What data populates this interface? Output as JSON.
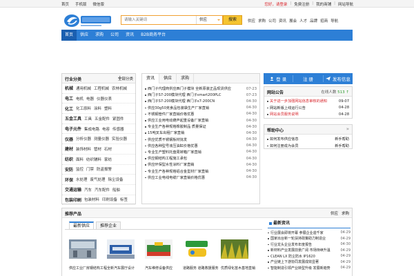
{
  "topbar": {
    "left": [
      "首页",
      "手机版",
      "微信版"
    ],
    "right": [
      "您好，请登录",
      "免费注册",
      "我的商铺",
      "网站导航"
    ]
  },
  "search": {
    "placeholder": "请输入关键词",
    "select": "供应",
    "button": "搜索"
  },
  "hotlinks": [
    "供应",
    "求购",
    "公司",
    "资讯",
    "展会",
    "人才",
    "品牌",
    "招商",
    "导航"
  ],
  "nav": [
    {
      "label": "首页",
      "active": true
    },
    {
      "label": "供应"
    },
    {
      "label": "求购"
    },
    {
      "label": "公司"
    },
    {
      "label": "资讯"
    },
    {
      "label": "B2B商务平台"
    }
  ],
  "categories": {
    "title": "行业分类",
    "all": "全部分类",
    "rows": [
      {
        "main": "机械",
        "subs": [
          "通用机械",
          "工程机械",
          "农林机械"
        ]
      },
      {
        "main": "电工",
        "subs": [
          "电机",
          "电器",
          "仪器仪表"
        ]
      },
      {
        "main": "化工",
        "subs": [
          "化工原料",
          "涂料",
          "塑料"
        ]
      },
      {
        "main": "五金工具",
        "subs": [
          "工具",
          "五金配件",
          "紧固件"
        ]
      },
      {
        "main": "电子元件",
        "subs": [
          "集成电路",
          "电容",
          "传感器"
        ]
      },
      {
        "main": "仪器",
        "subs": [
          "分析仪器",
          "测量仪器",
          "实验仪器"
        ]
      },
      {
        "main": "建材",
        "subs": [
          "装饰材料",
          "管材",
          "石材"
        ]
      },
      {
        "main": "纺织",
        "subs": [
          "面料",
          "纺织辅料",
          "家纺"
        ]
      },
      {
        "main": "安防",
        "subs": [
          "监控",
          "门禁",
          "防盗报警"
        ]
      },
      {
        "main": "环保",
        "subs": [
          "水处理",
          "废气处理",
          "除尘设备"
        ]
      },
      {
        "main": "交通运输",
        "subs": [
          "汽车",
          "汽车配件",
          "船舶"
        ]
      },
      {
        "main": "包装印刷",
        "subs": [
          "包装材料",
          "印刷设备",
          "标签"
        ]
      }
    ]
  },
  "news": {
    "tabs": [
      "资讯",
      "供应",
      "求购"
    ],
    "rows": [
      {
        "title": "西门子代理商供应西门子模块 全新原装正品现货供应",
        "date": "07-23"
      },
      {
        "title": "西门子S7-200模块代理 西门子smart200PLC",
        "date": "07-23"
      },
      {
        "title": "西门子S7-200模块代理 西门子s7-200CN",
        "date": "04-30"
      },
      {
        "title": "供应30g50克食品包装袋生产厂家直销",
        "date": "04-30"
      },
      {
        "title": "不锈钢管件厂家直销价格优惠",
        "date": "04-30"
      },
      {
        "title": "供应工业用电动葫芦起重设备厂家直销",
        "date": "04-30"
      },
      {
        "title": "专业生产各种规格橡胶制品 质量保证",
        "date": "04-30"
      },
      {
        "title": "15吨叉车出租厂家直销",
        "date": "04-30"
      },
      {
        "title": "供应优质不锈钢板材批发",
        "date": "04-30"
      },
      {
        "title": "供应各种型号液压油缸价格优惠",
        "date": "04-30"
      },
      {
        "title": "专业生产塑料托盘周转箱厂家直销",
        "date": "04-30"
      },
      {
        "title": "供应钢结构工程施工承包",
        "date": "04-30"
      },
      {
        "title": "供应环保型水性涂料厂家直销",
        "date": "04-30"
      },
      {
        "title": "专业生产各种规格铝合金型材厂家直销",
        "date": "04-30"
      },
      {
        "title": "供应工业电线电缆厂家直销价格优惠",
        "date": "04-30"
      }
    ]
  },
  "account": {
    "login": "登 录",
    "register": "注 册",
    "publish": "发布信息"
  },
  "notice": {
    "title": "网站公告",
    "online_label": "在线人数",
    "online_value": "513",
    "rows": [
      {
        "title": "关于进一步加强网站信息审核的通知",
        "date": "09-07",
        "highlight": true
      },
      {
        "title": "网站新版上线运行公告",
        "date": "04-28",
        "highlight": false
      },
      {
        "title": "网站会员服务说明",
        "date": "04-28",
        "highlight": true
      }
    ]
  },
  "tips": {
    "title": "帮助中心",
    "more": "»",
    "rows": [
      {
        "title": "如何发布供应信息",
        "tag": "新手帮助"
      },
      {
        "title": "如何注册成为会员",
        "tag": "新手帮助"
      }
    ]
  },
  "products": {
    "title": "推荐产品",
    "right": [
      "供应",
      "求购"
    ],
    "subtabs": [
      "最新供应",
      "推荐企业"
    ],
    "thumbs": [
      {
        "caption": "供应工业厂房钢结构工程"
      },
      {
        "caption": "全新汽车展厅设计"
      },
      {
        "caption": "汽车维修设备供应"
      },
      {
        "caption": "道路服务 道路救援服务"
      },
      {
        "caption": "优质绿化苗木基地直销"
      }
    ],
    "latest": {
      "title": "最新资讯",
      "rows": [
        {
          "title": "行业展会即将开幕 参展企业逾千家",
          "date": "04-29"
        },
        {
          "title": "国家出台新一轮扶持政策助力制造业",
          "date": "04-29"
        },
        {
          "title": "行业龙头企业发布年度报告",
          "date": "04-30"
        },
        {
          "title": "新材料产业发展前景广阔 市场持续升温",
          "date": "04-29"
        },
        {
          "title": "CLEAN LX 防尘防水 IP1620",
          "date": "04-29"
        },
        {
          "title": "产业链上下游协同发展成效显著",
          "date": "04-29"
        },
        {
          "title": "智能制造引领产业转型升级 发展新趋势",
          "date": "04-29"
        }
      ]
    }
  },
  "colors": {
    "brand": "#2d7fd6",
    "accent": "#f5c430",
    "highlight": "#d8262c"
  }
}
